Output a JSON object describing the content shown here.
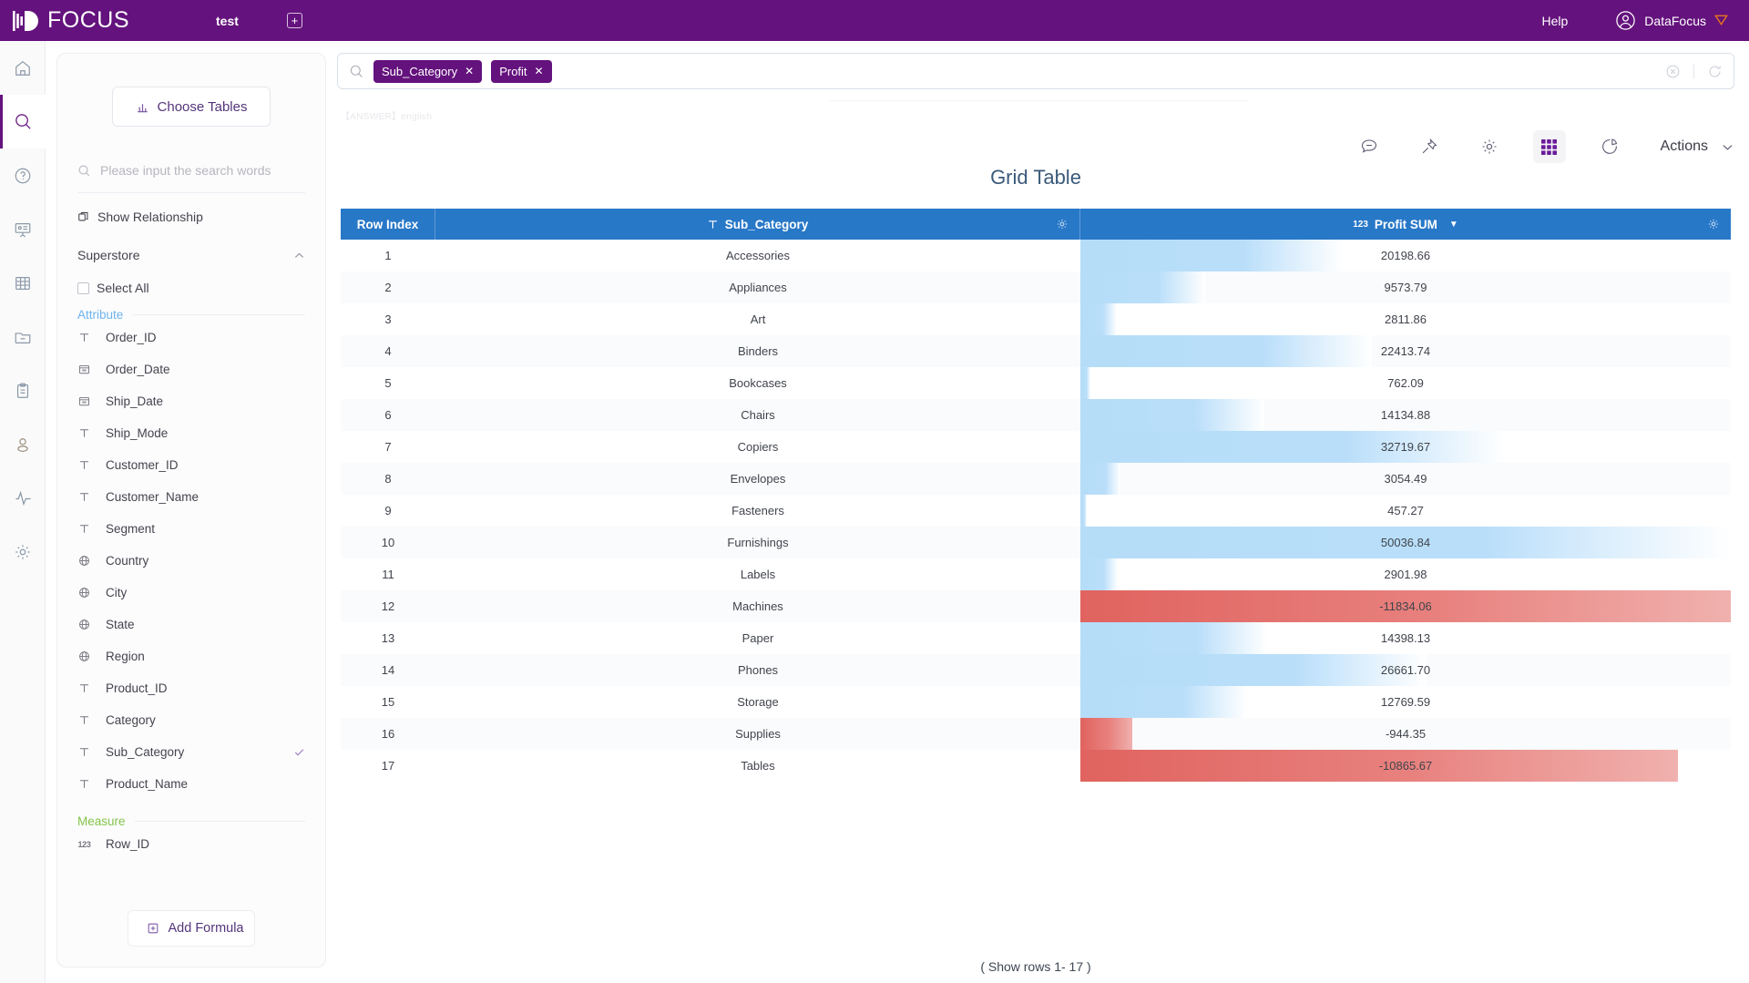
{
  "app": {
    "brand": "FOCUS",
    "tab_label": "test",
    "add_tab_icon": "plus-icon",
    "help_label": "Help",
    "user_name": "DataFocus",
    "user_avatar_icon": "user-circle-icon",
    "user_badge_icon": "shield-badge-icon",
    "brand_color": "#64127d",
    "accent_blue": "#2878c8"
  },
  "rail": {
    "items": [
      {
        "icon": "home-icon",
        "name": "home",
        "active": false
      },
      {
        "icon": "search-icon",
        "name": "search",
        "active": true
      },
      {
        "icon": "question-circle-icon",
        "name": "help",
        "active": false
      },
      {
        "icon": "presentation-icon",
        "name": "dashboard",
        "active": false
      },
      {
        "icon": "grid-table-icon",
        "name": "tables",
        "active": false
      },
      {
        "icon": "folder-minus-icon",
        "name": "folder",
        "active": false
      },
      {
        "icon": "clipboard-icon",
        "name": "tasks",
        "active": false
      },
      {
        "icon": "user-icon",
        "name": "account",
        "active": false
      },
      {
        "icon": "pulse-icon",
        "name": "monitor",
        "active": false
      },
      {
        "icon": "gear-icon",
        "name": "settings",
        "active": false
      }
    ]
  },
  "sidebar": {
    "choose_tables_label": "Choose Tables",
    "choose_tables_icon": "bar-chart-icon",
    "search_placeholder": "Please input the search words",
    "search_icon": "search-icon",
    "show_relationship_label": "Show Relationship",
    "show_relationship_icon": "relationship-icon",
    "datasource_name": "Superstore",
    "datasource_collapse_icon": "chevron-up-icon",
    "select_all_label": "Select All",
    "select_all_checked": false,
    "attribute_group_label": "Attribute",
    "measure_group_label": "Measure",
    "attribute_fields": [
      {
        "label": "Order_ID",
        "icon": "text-type-icon",
        "selected": false
      },
      {
        "label": "Order_Date",
        "icon": "date-type-icon",
        "selected": false
      },
      {
        "label": "Ship_Date",
        "icon": "date-type-icon",
        "selected": false
      },
      {
        "label": "Ship_Mode",
        "icon": "text-type-icon",
        "selected": false
      },
      {
        "label": "Customer_ID",
        "icon": "text-type-icon",
        "selected": false
      },
      {
        "label": "Customer_Name",
        "icon": "text-type-icon",
        "selected": false
      },
      {
        "label": "Segment",
        "icon": "text-type-icon",
        "selected": false
      },
      {
        "label": "Country",
        "icon": "geo-type-icon",
        "selected": false
      },
      {
        "label": "City",
        "icon": "geo-type-icon",
        "selected": false
      },
      {
        "label": "State",
        "icon": "geo-type-icon",
        "selected": false
      },
      {
        "label": "Region",
        "icon": "geo-type-icon",
        "selected": false
      },
      {
        "label": "Product_ID",
        "icon": "text-type-icon",
        "selected": false
      },
      {
        "label": "Category",
        "icon": "text-type-icon",
        "selected": false
      },
      {
        "label": "Sub_Category",
        "icon": "text-type-icon",
        "selected": true
      },
      {
        "label": "Product_Name",
        "icon": "text-type-icon",
        "selected": false
      }
    ],
    "measure_fields": [
      {
        "label": "Row_ID",
        "icon": "number-type-icon",
        "selected": false
      }
    ],
    "add_formula_label": "Add Formula",
    "add_formula_icon": "plus-square-icon"
  },
  "search": {
    "icon": "search-icon",
    "chips": [
      {
        "label": "Sub_Category",
        "remove_icon": "close-icon"
      },
      {
        "label": "Profit",
        "remove_icon": "close-icon"
      }
    ],
    "clear_icon": "clear-circle-icon",
    "refresh_icon": "refresh-icon"
  },
  "main": {
    "answer_tag": "【ANSWER】english",
    "toolbar": [
      {
        "icon": "comment-icon",
        "name": "comment",
        "active": false
      },
      {
        "icon": "pin-icon",
        "name": "pin",
        "active": false
      },
      {
        "icon": "gear-icon",
        "name": "settings",
        "active": false
      },
      {
        "icon": "grid-icon",
        "name": "grid-view",
        "active": true
      },
      {
        "icon": "pie-chart-icon",
        "name": "chart-view",
        "active": false
      }
    ],
    "actions_label": "Actions",
    "actions_chevron_icon": "chevron-down-icon",
    "chart_title": "Grid Table",
    "footer_rows": "( Show rows 1- 17 )"
  },
  "chart_data": {
    "type": "table",
    "title": "Grid Table",
    "columns": [
      {
        "label": "Row Index",
        "type_icon": "",
        "sorted": false
      },
      {
        "label": "Sub_Category",
        "type_icon": "text-type-icon",
        "sorted": false,
        "gear_icon": "gear-icon"
      },
      {
        "label": "Profit SUM",
        "type_icon": "number-type-icon",
        "sorted": true,
        "sort_direction": "desc",
        "sort_icon": "caret-down-icon",
        "gear_icon": "gear-icon"
      }
    ],
    "categories": [
      "Accessories",
      "Appliances",
      "Art",
      "Binders",
      "Bookcases",
      "Chairs",
      "Copiers",
      "Envelopes",
      "Fasteners",
      "Furnishings",
      "Labels",
      "Machines",
      "Paper",
      "Phones",
      "Storage",
      "Supplies",
      "Tables"
    ],
    "values": [
      20198.66,
      9573.79,
      2811.86,
      22413.74,
      762.09,
      14134.88,
      32719.67,
      3054.49,
      457.27,
      50036.84,
      2901.98,
      -11834.06,
      14398.13,
      26661.7,
      12769.59,
      -944.35,
      -10865.67
    ],
    "rows": [
      {
        "index": "1",
        "category": "Accessories",
        "value": "20198.66",
        "raw": 20198.66
      },
      {
        "index": "2",
        "category": "Appliances",
        "value": "9573.79",
        "raw": 9573.79
      },
      {
        "index": "3",
        "category": "Art",
        "value": "2811.86",
        "raw": 2811.86
      },
      {
        "index": "4",
        "category": "Binders",
        "value": "22413.74",
        "raw": 22413.74
      },
      {
        "index": "5",
        "category": "Bookcases",
        "value": "762.09",
        "raw": 762.09
      },
      {
        "index": "6",
        "category": "Chairs",
        "value": "14134.88",
        "raw": 14134.88
      },
      {
        "index": "7",
        "category": "Copiers",
        "value": "32719.67",
        "raw": 32719.67
      },
      {
        "index": "8",
        "category": "Envelopes",
        "value": "3054.49",
        "raw": 3054.49
      },
      {
        "index": "9",
        "category": "Fasteners",
        "value": "457.27",
        "raw": 457.27
      },
      {
        "index": "10",
        "category": "Furnishings",
        "value": "50036.84",
        "raw": 50036.84
      },
      {
        "index": "11",
        "category": "Labels",
        "value": "2901.98",
        "raw": 2901.98
      },
      {
        "index": "12",
        "category": "Machines",
        "value": "-11834.06",
        "raw": -11834.06
      },
      {
        "index": "13",
        "category": "Paper",
        "value": "14398.13",
        "raw": 14398.13
      },
      {
        "index": "14",
        "category": "Phones",
        "value": "26661.70",
        "raw": 26661.7
      },
      {
        "index": "15",
        "category": "Storage",
        "value": "12769.59",
        "raw": 12769.59
      },
      {
        "index": "16",
        "category": "Supplies",
        "value": "-944.35",
        "raw": -944.35
      },
      {
        "index": "17",
        "category": "Tables",
        "value": "-10865.67",
        "raw": -10865.67
      }
    ],
    "xlabel": "",
    "ylabel": "Profit SUM",
    "positive_bar_color": "#b5ddf8",
    "negative_bar_color": "#e0635f",
    "max_value": 50036.84,
    "min_value": -11834.06
  }
}
